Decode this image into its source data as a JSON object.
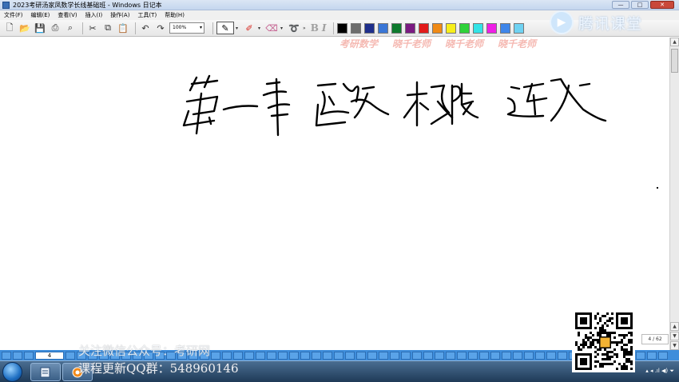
{
  "window": {
    "title": "2023考研汤家凤数学长线基础班 - Windows 日记本",
    "controls": {
      "minimize": "—",
      "maximize": "□",
      "close": "✕"
    }
  },
  "menu": [
    "文件(F)",
    "编辑(E)",
    "查看(V)",
    "插入(I)",
    "操作(A)",
    "工具(T)",
    "帮助(H)"
  ],
  "toolbar": {
    "zoom": "100%",
    "overflow": "»",
    "bold": "B",
    "italic": "I",
    "colors": [
      "#000000",
      "#6d6d6d",
      "#1f2f8c",
      "#3a76d6",
      "#0e7a2e",
      "#7b1b82",
      "#e21b1b",
      "#f08a16",
      "#f7ee1a",
      "#2fd23a",
      "#33e3e6",
      "#ef1fe6",
      "#3f86ea",
      "#6fd2f2"
    ]
  },
  "brand_logo": {
    "text": "腾讯课堂"
  },
  "watermarks": [
    "考研数学",
    "晓千老师",
    "晓千老师",
    "晓千老师"
  ],
  "page_counter": "4 / 62",
  "current_page": "4",
  "overlay": {
    "follow_notice": "关注微信公众号：考研网",
    "qq_group": "课程更新QQ群：548960146"
  },
  "taskbar": {
    "tray": "▴ ◂ .ıl ◀) ⏷"
  }
}
